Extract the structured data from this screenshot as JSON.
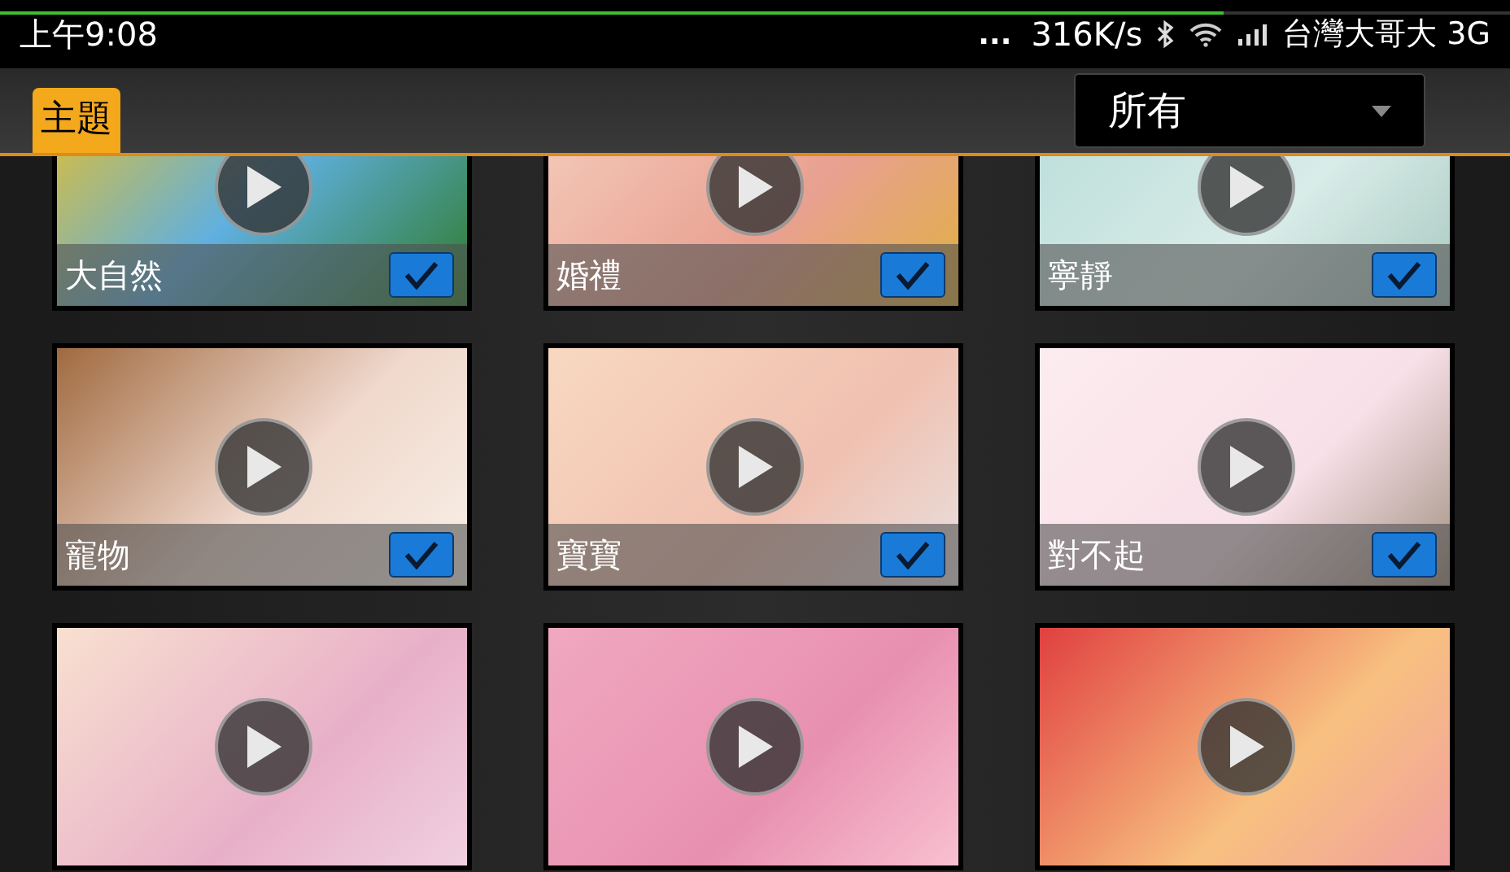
{
  "status_bar": {
    "time": "上午9:08",
    "more": "...",
    "speed": "316K/s",
    "carrier": "台灣大哥大 3G",
    "progress": {
      "level": 0.81
    }
  },
  "toolbar": {
    "tab": "主題",
    "filter": "所有"
  },
  "themes": [
    {
      "kind": "labeled",
      "label": "大自然",
      "checked": true
    },
    {
      "kind": "labeled",
      "label": "婚禮",
      "checked": true
    },
    {
      "kind": "labeled",
      "label": "寧靜",
      "checked": true
    },
    {
      "kind": "labeled",
      "label": "寵物",
      "checked": true
    },
    {
      "kind": "labeled",
      "label": "寶寶",
      "checked": true
    },
    {
      "kind": "labeled",
      "label": "對不起",
      "checked": true
    },
    {
      "kind": "cut"
    },
    {
      "kind": "cut"
    },
    {
      "kind": "cut"
    }
  ]
}
